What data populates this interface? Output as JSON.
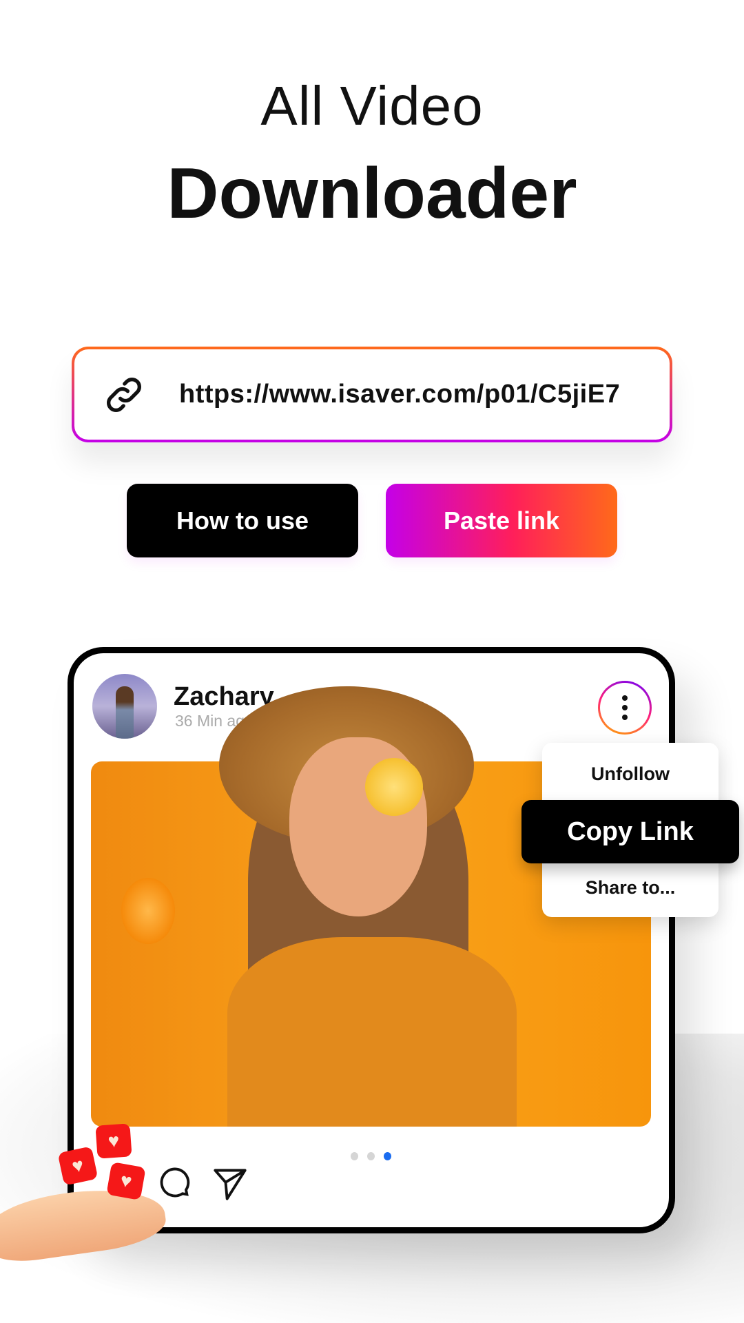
{
  "header": {
    "title_line1": "All Video",
    "title_line2": "Downloader"
  },
  "url_input": {
    "value": "https://www.isaver.com/p01/C5jiE7",
    "icon": "link-icon"
  },
  "buttons": {
    "how_to_use": "How to use",
    "paste_link": "Paste link"
  },
  "colors": {
    "gradient_start": "#c400e8",
    "gradient_mid": "#ff1f5a",
    "gradient_end": "#ff6a1a",
    "active_dot": "#1a6cf0"
  },
  "post": {
    "username": "Zachary",
    "time": "36 Min ago",
    "menu": {
      "items": [
        "Unfollow",
        "Copy Link",
        "Share to..."
      ],
      "highlighted": "Copy Link"
    },
    "carousel": {
      "count": 3,
      "active": 3
    },
    "actions": [
      "comment-icon",
      "share-icon"
    ]
  }
}
